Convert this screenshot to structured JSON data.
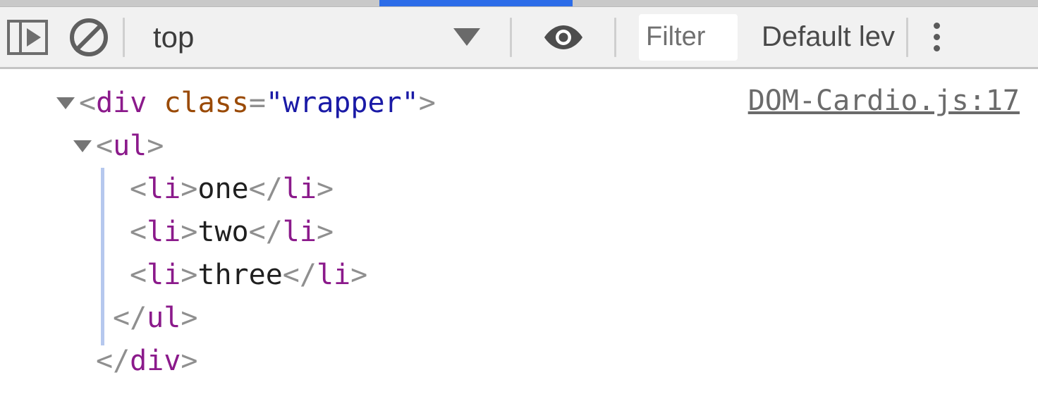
{
  "tabstrip": {
    "active_tab_accent": "#2c6ce8"
  },
  "toolbar": {
    "sidebar_toggle_icon": "sidebar-toggle-icon",
    "clear_console_icon": "clear-console-icon",
    "context_selector": {
      "value": "top",
      "dropdown_icon": "chevron-down-icon"
    },
    "live_expression_icon": "eye-icon",
    "filter": {
      "value": "",
      "placeholder": "Filter"
    },
    "level_selector": {
      "value": "Default lev",
      "full_value": "Default levels"
    },
    "overflow_icon": "kebab-menu-icon",
    "background": "#f1f1f1"
  },
  "console": {
    "entries": [
      {
        "source": "DOM-Cardio.js:17",
        "lines": [
          {
            "indent": 0,
            "twisty": true,
            "tokens": [
              {
                "text": "<",
                "type": "punct"
              },
              {
                "text": "div",
                "type": "tagname"
              },
              {
                "text": " ",
                "type": "punct"
              },
              {
                "text": "class",
                "type": "attrname"
              },
              {
                "text": "=",
                "type": "punct"
              },
              {
                "text": "\"wrapper\"",
                "type": "attrvalue"
              },
              {
                "text": ">",
                "type": "punct"
              }
            ]
          },
          {
            "indent": 1,
            "twisty": true,
            "tokens": [
              {
                "text": "<",
                "type": "punct"
              },
              {
                "text": "ul",
                "type": "tagname"
              },
              {
                "text": ">",
                "type": "punct"
              }
            ]
          },
          {
            "indent": 3,
            "twisty": false,
            "tokens": [
              {
                "text": "<",
                "type": "punct"
              },
              {
                "text": "li",
                "type": "tagname"
              },
              {
                "text": ">",
                "type": "punct"
              },
              {
                "text": "one",
                "type": "textnode"
              },
              {
                "text": "</",
                "type": "punct"
              },
              {
                "text": "li",
                "type": "tagname"
              },
              {
                "text": ">",
                "type": "punct"
              }
            ]
          },
          {
            "indent": 3,
            "twisty": false,
            "tokens": [
              {
                "text": "<",
                "type": "punct"
              },
              {
                "text": "li",
                "type": "tagname"
              },
              {
                "text": ">",
                "type": "punct"
              },
              {
                "text": "two",
                "type": "textnode"
              },
              {
                "text": "</",
                "type": "punct"
              },
              {
                "text": "li",
                "type": "tagname"
              },
              {
                "text": ">",
                "type": "punct"
              }
            ]
          },
          {
            "indent": 3,
            "twisty": false,
            "tokens": [
              {
                "text": "<",
                "type": "punct"
              },
              {
                "text": "li",
                "type": "tagname"
              },
              {
                "text": ">",
                "type": "punct"
              },
              {
                "text": "three",
                "type": "textnode"
              },
              {
                "text": "</",
                "type": "punct"
              },
              {
                "text": "li",
                "type": "tagname"
              },
              {
                "text": ">",
                "type": "punct"
              }
            ]
          },
          {
            "indent": 2,
            "twisty": false,
            "tokens": [
              {
                "text": "</",
                "type": "punct"
              },
              {
                "text": "ul",
                "type": "tagname"
              },
              {
                "text": ">",
                "type": "punct"
              }
            ]
          },
          {
            "indent": 1,
            "twisty": false,
            "tokens": [
              {
                "text": "</",
                "type": "punct"
              },
              {
                "text": "div",
                "type": "tagname"
              },
              {
                "text": ">",
                "type": "punct"
              }
            ]
          }
        ]
      }
    ]
  },
  "colors": {
    "punct": "#8f8f8f",
    "tagname": "#8b1a8b",
    "attrname": "#9a4a06",
    "attrvalue": "#1a1aa6",
    "textnode": "#1f1f1f",
    "indent_guide": "#b6c8ee",
    "source_link": "#6b6b6b"
  }
}
